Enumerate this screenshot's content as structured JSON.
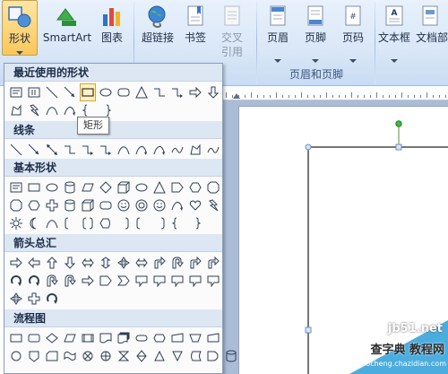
{
  "ribbon": {
    "buttons": [
      {
        "id": "shapes",
        "label": "形状",
        "icon": "shapes-icon"
      },
      {
        "id": "smartart",
        "label": "SmartArt",
        "icon": "smartart-icon"
      },
      {
        "id": "chart",
        "label": "图表",
        "icon": "chart-icon"
      },
      {
        "id": "hyperlink",
        "label": "超链接",
        "icon": "hyperlink-globe-icon"
      },
      {
        "id": "bookmark",
        "label": "书签",
        "icon": "bookmark-icon"
      },
      {
        "id": "crossref",
        "label": "交叉",
        "label2": "引用",
        "icon": "cross-reference-icon"
      },
      {
        "id": "header",
        "label": "页眉",
        "icon": "header-icon"
      },
      {
        "id": "footer",
        "label": "页脚",
        "icon": "footer-icon"
      },
      {
        "id": "pagenum",
        "label": "页码",
        "icon": "page-number-icon"
      },
      {
        "id": "textbox",
        "label": "文本框",
        "icon": "textbox-icon"
      },
      {
        "id": "docparts",
        "label": "文档部",
        "icon": "document-parts-icon"
      }
    ],
    "group_label": "页眉和页脚"
  },
  "menu": {
    "sections": [
      "最近使用的形状",
      "线条",
      "基本形状",
      "箭头总汇",
      "流程图"
    ],
    "tooltip": "矩形"
  },
  "watermark": {
    "site1": "jb51.net",
    "site2": "查字典 教程网",
    "site3": "jiaocheng.chazidian.com"
  },
  "colors": {
    "ribbon_bg": "#dbe8f8",
    "active_button": "#fbc65a",
    "menu_header": "#dde7f4",
    "workspace": "#abbcd7",
    "handle_green": "#3cba3c",
    "handle_blue": "#6a8fc8"
  }
}
